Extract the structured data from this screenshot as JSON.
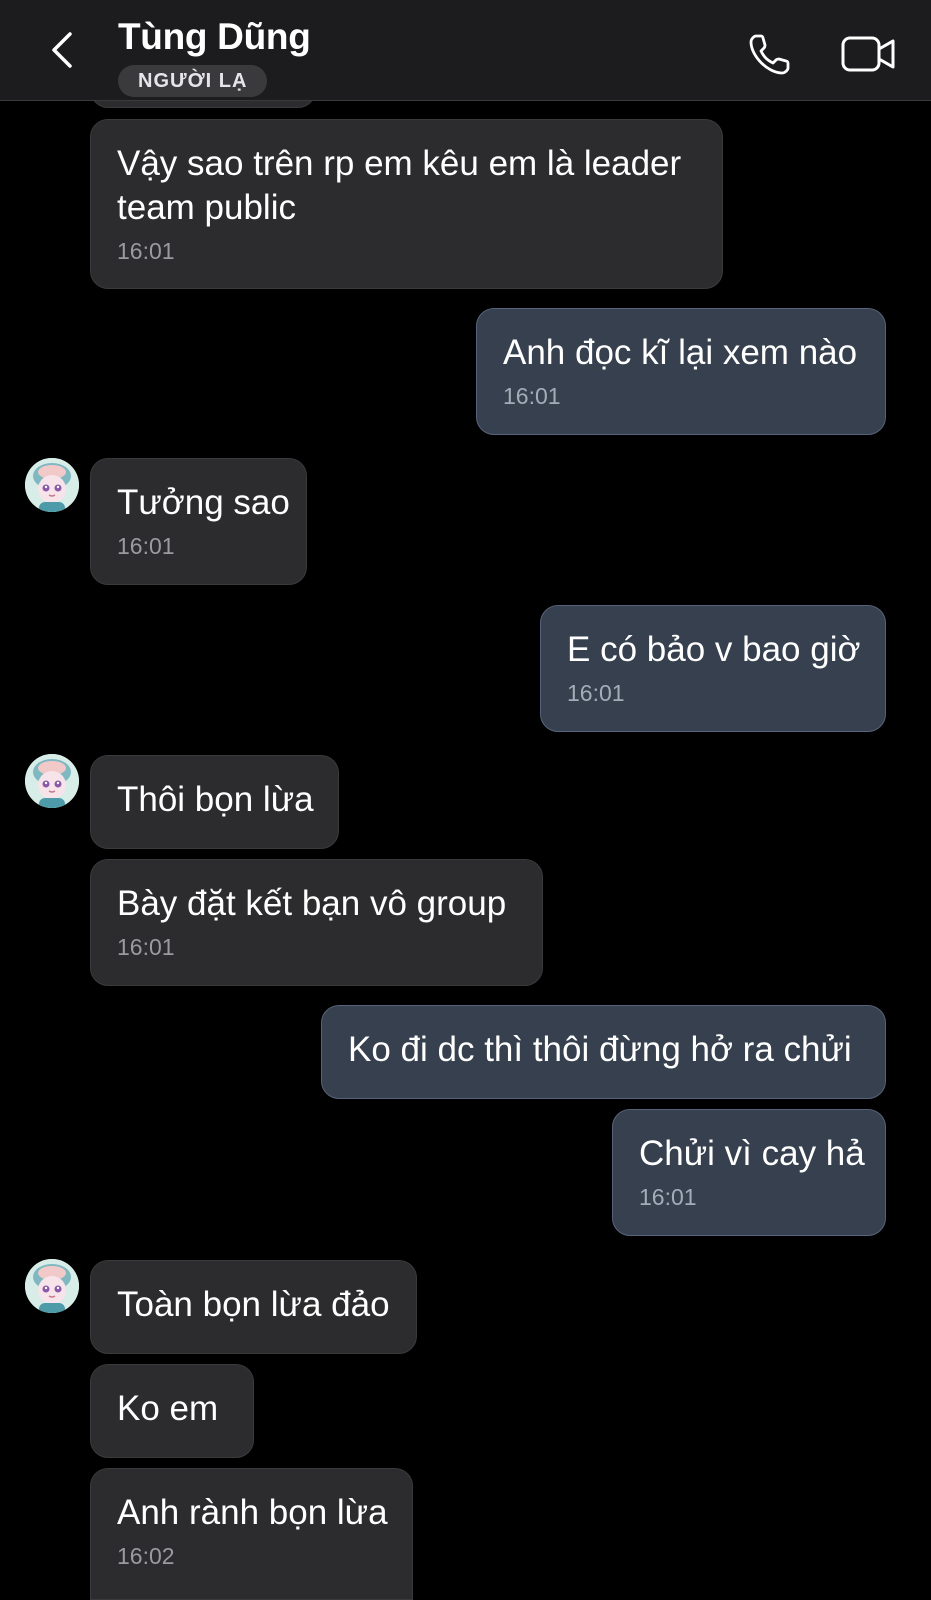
{
  "header": {
    "contact_name": "Tùng Dũng",
    "badge": "NGƯỜI LẠ",
    "icons": {
      "back": "chevron-left-icon",
      "call": "phone-icon",
      "video": "video-camera-icon"
    }
  },
  "colors": {
    "background": "#000000",
    "header_bg": "#1c1c1e",
    "incoming_bubble": "#2c2c2e",
    "outgoing_bubble": "#36404e",
    "text": "#ffffff",
    "timestamp": "#9a9aa0"
  },
  "messages": [
    {
      "text": "Vậy sao trên rp em kêu em là leader",
      "text2": "team public",
      "time": "16:01"
    },
    {
      "text": "Anh đọc kĩ lại xem nào",
      "time": "16:01"
    },
    {
      "text": "Tưởng sao",
      "time": "16:01"
    },
    {
      "text": "E có bảo v bao giờ",
      "time": "16:01"
    },
    {
      "text": "Thôi bọn lừa"
    },
    {
      "text": "Bày đặt kết bạn vô group",
      "time": "16:01"
    },
    {
      "text": "Ko đi dc thì thôi đừng hở ra chửi"
    },
    {
      "text": "Chửi vì cay hả",
      "time": "16:01"
    },
    {
      "text": "Toàn bọn lừa đảo"
    },
    {
      "text": "Ko em"
    },
    {
      "text": "Anh rành bọn lừa",
      "time": "16:02"
    }
  ]
}
